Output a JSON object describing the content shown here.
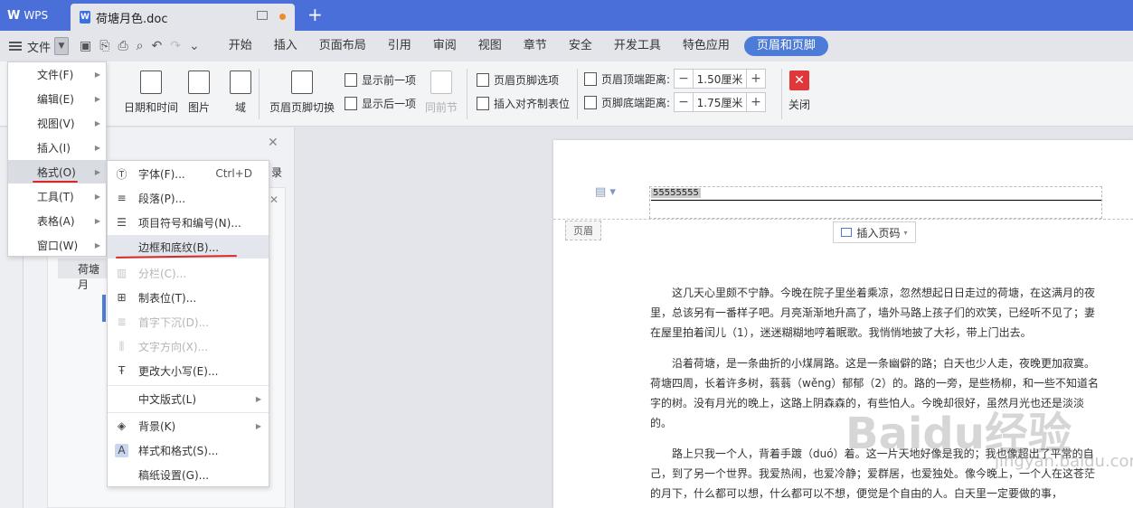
{
  "titlebar": {
    "app_label": "WPS",
    "doc_tab": "荷塘月色.doc",
    "new_tab": "+"
  },
  "menubar": {
    "file_label": "文件",
    "items": [
      "开始",
      "插入",
      "页面布局",
      "引用",
      "审阅",
      "视图",
      "章节",
      "安全",
      "开发工具",
      "特色应用"
    ],
    "active": "页眉和页脚"
  },
  "toolbar": {
    "date_time": "日期和时间",
    "picture": "图片",
    "field": "域",
    "hf_switch": "页眉页脚切换",
    "show_prev": "显示前一项",
    "show_next": "显示后一项",
    "same_prev": "同前节",
    "hf_options": "页眉页脚选项",
    "insert_align_tab": "插入对齐制表位",
    "header_top_label": "页眉顶端距离:",
    "header_top_value": "1.50厘米",
    "footer_bottom_label": "页脚底端距离:",
    "footer_bottom_value": "1.75厘米",
    "close": "关闭",
    "minus": "−",
    "plus": "+"
  },
  "nav_panel": {
    "catalog_fragment": "录",
    "item": "荷塘月"
  },
  "document": {
    "header_text": "55555555",
    "header_label": "页眉",
    "insert_page_number": "插入页码",
    "paragraphs": [
      "这几天心里颇不宁静。今晚在院子里坐着乘凉，忽然想起日日走过的荷塘，在这满月的夜里，总该另有一番样子吧。月亮渐渐地升高了，墙外马路上孩子们的欢笑，已经听不见了；妻在屋里拍着闰儿（1），迷迷糊糊地哼着眠歌。我悄悄地披了大衫，带上门出去。",
      "沿着荷塘，是一条曲折的小煤屑路。这是一条幽僻的路；白天也少人走，夜晚更加寂寞。荷塘四周，长着许多树，蓊蓊（wěng）郁郁（2）的。路的一旁，是些杨柳，和一些不知道名字的树。没有月光的晚上，这路上阴森森的，有些怕人。今晚却很好，虽然月光也还是淡淡的。",
      "路上只我一个人，背着手踱（duó）着。这一片天地好像是我的；我也像超出了平常的自己，到了另一个世界。我爱热闹，也爱冷静；爱群居，也爱独处。像今晚上，一个人在这苍茫的月下，什么都可以想，什么都可以不想，便觉是个自由的人。白天里一定要做的事，"
    ],
    "watermark": "Baidu经验",
    "watermark_sub": "jingyan.baidu.com"
  },
  "menu_main": {
    "items": [
      {
        "label": "文件(F)"
      },
      {
        "label": "编辑(E)"
      },
      {
        "label": "视图(V)"
      },
      {
        "label": "插入(I)"
      },
      {
        "label": "格式(O)"
      },
      {
        "label": "工具(T)"
      },
      {
        "label": "表格(A)"
      },
      {
        "label": "窗口(W)"
      }
    ],
    "selected": "格式(O)"
  },
  "menu_format": {
    "items": [
      {
        "label": "字体(F)...",
        "shortcut": "Ctrl+D",
        "icon": "font-icon",
        "enabled": true
      },
      {
        "label": "段落(P)...",
        "icon": "paragraph-icon",
        "enabled": true
      },
      {
        "label": "项目符号和编号(N)...",
        "icon": "bullet-list-icon",
        "enabled": true
      },
      {
        "label": "边框和底纹(B)...",
        "icon": "border-icon",
        "enabled": true
      },
      {
        "label": "分栏(C)...",
        "icon": "columns-icon",
        "enabled": false
      },
      {
        "label": "制表位(T)...",
        "icon": "tab-stop-icon",
        "enabled": true
      },
      {
        "label": "首字下沉(D)...",
        "icon": "drop-cap-icon",
        "enabled": false
      },
      {
        "label": "文字方向(X)...",
        "icon": "text-direction-icon",
        "enabled": false
      },
      {
        "label": "更改大小写(E)...",
        "icon": "change-case-icon",
        "enabled": true
      },
      {
        "label": "中文版式(L)",
        "icon": "",
        "enabled": true,
        "submenu": true
      },
      {
        "label": "背景(K)",
        "icon": "background-icon",
        "enabled": true,
        "submenu": true
      },
      {
        "label": "样式和格式(S)...",
        "icon": "style-icon",
        "enabled": true
      },
      {
        "label": "稿纸设置(G)...",
        "icon": "",
        "enabled": true
      }
    ],
    "highlighted": "边框和底纹(B)..."
  },
  "colors": {
    "title_bar": "#4b6fd8",
    "accent": "#4d7bd8",
    "annotation_red": "#d52a2a",
    "close_red": "#e0373a"
  }
}
